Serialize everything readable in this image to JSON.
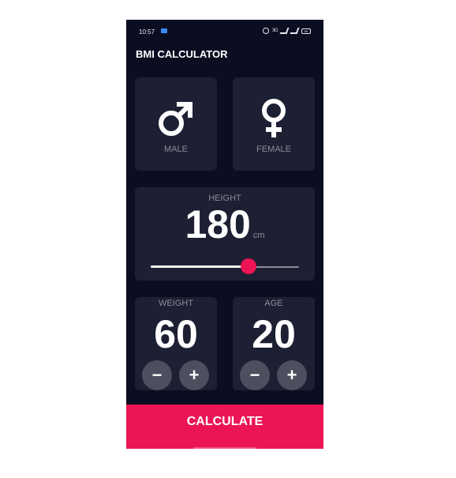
{
  "status_bar": {
    "time": "10:57",
    "network": "3G",
    "battery": "60"
  },
  "app_bar": {
    "title": "BMI CALCULATOR"
  },
  "gender": {
    "male_label": "MALE",
    "female_label": "FEMALE",
    "male_icon": "male-symbol-icon",
    "female_icon": "female-symbol-icon"
  },
  "height": {
    "label": "HEIGHT",
    "value": "180",
    "unit": "cm",
    "slider_fraction": 0.59
  },
  "weight": {
    "label": "WEIGHT",
    "value": "60",
    "minus": "−",
    "plus": "+"
  },
  "age": {
    "label": "AGE",
    "value": "20",
    "minus": "−",
    "plus": "+"
  },
  "calculate_label": "CALCULATE",
  "colors": {
    "background": "#0b0e21",
    "card": "#1d1f33",
    "accent": "#eb1555",
    "button": "#4c4f5e",
    "muted_text": "#8d8e98"
  }
}
